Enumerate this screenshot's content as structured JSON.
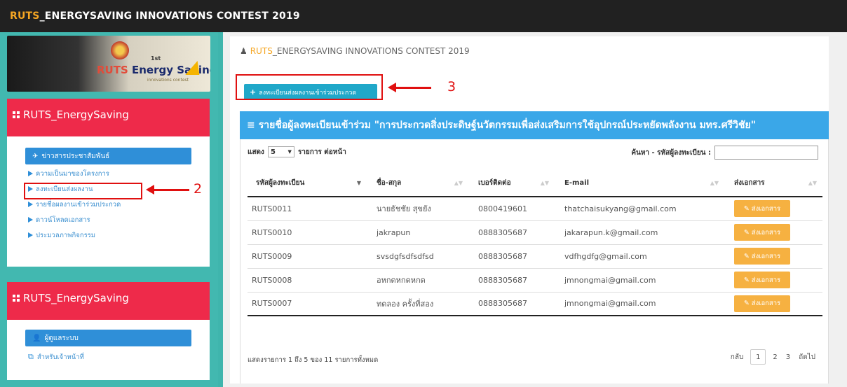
{
  "topbar": {
    "title_accent": "RUTS",
    "title_rest": "_ENERGYSAVING INNOVATIONS CONTEST 2019"
  },
  "logo": {
    "text_accent": "RUTS",
    "text_rest": " Energy Saving",
    "sub": "1st",
    "tag": "innovations contest"
  },
  "panel1": {
    "title": "RUTS_EnergySaving",
    "active_item": "ข่าวสารประชาสัมพันธ์",
    "items": [
      "ความเป็นมาของโครงการ",
      "ลงทะเบียนส่งผลงาน",
      "รายชื่อผลงานเข้าร่วมประกวด",
      "ดาวน์โหลดเอกสาร",
      "ประมวลภาพกิจกรรม"
    ]
  },
  "panel2": {
    "title": "RUTS_EnergySaving",
    "active_item": "ผู้ดูแลระบบ",
    "items": [
      "สำหรับเจ้าหน้าที่"
    ]
  },
  "callouts": {
    "two": "2",
    "three": "3"
  },
  "main": {
    "title_accent": "RUTS",
    "title_rest": "_ENERGYSAVING INNOVATIONS CONTEST 2019",
    "register_button": "ลงทะเบียนส่งผลงานเข้าร่วมประกวด",
    "table_title": "รายชื่อผู้ลงทะเบียนเข้าร่วม \"การประกวดสิ่งประดิษฐ์นวัตกรรมเพื่อส่งเสริมการใช้อุปกรณ์ประหยัดพลังงาน มทร.ศรีวิชัย\"",
    "show_label": "แสดง",
    "page_size": "5",
    "per_page_label": "รายการ ต่อหน้า",
    "search_label": "ค้นหา - รหัสผู้ลงทะเบียน :",
    "columns": [
      "รหัสผู้ลงทะเบียน",
      "ชื่อ-สกุล",
      "เบอร์ติดต่อ",
      "E-mail",
      "ส่งเอกสาร"
    ],
    "rows": [
      {
        "id": "RUTS0011",
        "name": "นายธัชชัย สุขยัง",
        "phone": "0800419601",
        "email": "thatchaisukyang@gmail.com",
        "action": "ส่งเอกสาร"
      },
      {
        "id": "RUTS0010",
        "name": "jakrapun",
        "phone": "0888305687",
        "email": "jakarapun.k@gmail.com",
        "action": "ส่งเอกสาร"
      },
      {
        "id": "RUTS0009",
        "name": "svsdgfsdfsdfsd",
        "phone": "0888305687",
        "email": "vdfhgdfg@gmail.com",
        "action": "ส่งเอกสาร"
      },
      {
        "id": "RUTS0008",
        "name": "อหกดหกดหกด",
        "phone": "0888305687",
        "email": "jmnongmai@gmail.com",
        "action": "ส่งเอกสาร"
      },
      {
        "id": "RUTS0007",
        "name": "ทดลอง ครั้งที่สอง",
        "phone": "0888305687",
        "email": "jmnongmai@gmail.com",
        "action": "ส่งเอกสาร"
      }
    ],
    "info": "แสดงรายการ 1 ถึง 5 ของ 11 รายการทั้งหมด",
    "pager": {
      "prev": "กลับ",
      "pages": [
        "1",
        "2",
        "3"
      ],
      "next": "ถัดไป"
    }
  }
}
